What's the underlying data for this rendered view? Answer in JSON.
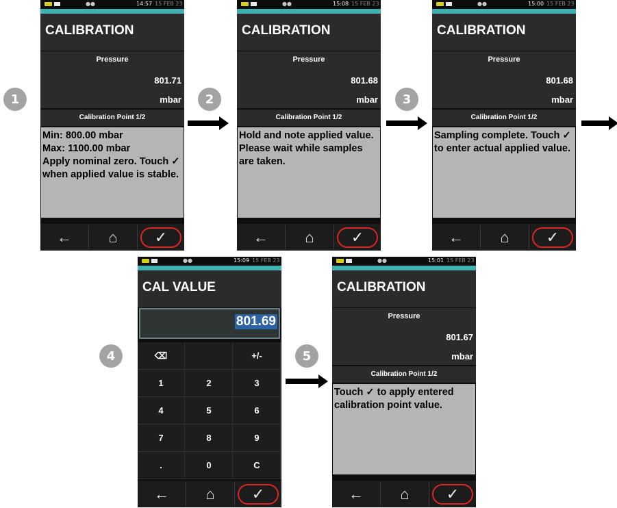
{
  "status": {
    "top_row": {
      "dots": "●●",
      "warn": "⚠"
    }
  },
  "screens": [
    {
      "time": "14:57",
      "date": "15 FEB 23",
      "title": "CALIBRATION",
      "param_name": "Pressure",
      "value": "801.71",
      "unit": "mbar",
      "cal_point": "Calibration Point 1/2",
      "message": "Min: 800.00 mbar\nMax: 1100.00 mbar\nApply nominal zero. Touch ✓ when applied value is stable.",
      "step": "1"
    },
    {
      "time": "15:08",
      "date": "15 FEB 23",
      "title": "CALIBRATION",
      "param_name": "Pressure",
      "value": "801.68",
      "unit": "mbar",
      "cal_point": "Calibration Point 1/2",
      "message": "Hold and note applied value. Please wait while samples are taken.",
      "step": "2"
    },
    {
      "time": "15:00",
      "date": "15 FEB 23",
      "title": "CALIBRATION",
      "param_name": "Pressure",
      "value": "801.68",
      "unit": "mbar",
      "cal_point": "Calibration Point 1/2",
      "message": "Sampling complete. Touch ✓ to enter actual applied value.",
      "step": "3"
    },
    {
      "time": "15:01",
      "date": "15 FEB 23",
      "title": "CALIBRATION",
      "param_name": "Pressure",
      "value": "801.67",
      "unit": "mbar",
      "cal_point": "Calibration Point 1/2",
      "message": "Touch ✓ to apply entered calibration point value.",
      "step": "5"
    }
  ],
  "cal_value_screen": {
    "time": "15:09",
    "date": "15 FEB 23",
    "title": "CAL VALUE",
    "entry": "801.69",
    "step": "4",
    "keys": [
      [
        "⌫",
        "",
        "+/-"
      ],
      [
        "1",
        "2",
        "3"
      ],
      [
        "4",
        "5",
        "6"
      ],
      [
        "7",
        "8",
        "9"
      ],
      [
        ".",
        "0",
        "C"
      ]
    ]
  },
  "nav": {
    "back": "←",
    "home": "⌂",
    "ok": "✓"
  }
}
